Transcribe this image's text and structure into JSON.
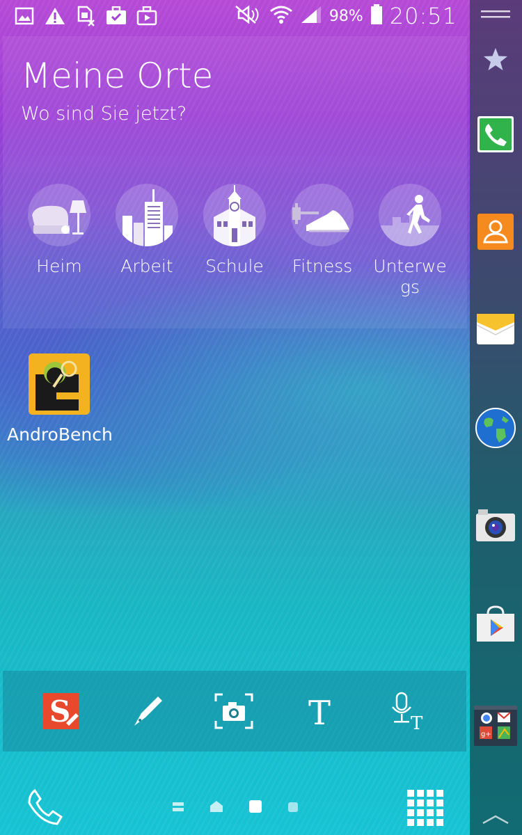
{
  "status_bar": {
    "left_icons": [
      "gallery-icon",
      "warning-icon",
      "sim-error-icon",
      "briefcase-check-icon",
      "briefcase-play-icon"
    ],
    "battery_percent": "98%",
    "time": "20:51"
  },
  "places_widget": {
    "title": "Meine Orte",
    "subtitle": "Wo sind Sie jetzt?",
    "places": [
      {
        "label": "Heim",
        "icon": "home-place-icon"
      },
      {
        "label": "Arbeit",
        "icon": "work-place-icon"
      },
      {
        "label": "Schule",
        "icon": "school-place-icon"
      },
      {
        "label": "Fitness",
        "icon": "fitness-place-icon"
      },
      {
        "label": "Unterwegs",
        "icon": "on-the-move-place-icon"
      }
    ]
  },
  "home_apps": [
    {
      "label": "AndroBench",
      "icon_text": "AndroBench"
    }
  ],
  "pen_tools": [
    "s-note-icon",
    "pen-icon",
    "screen-capture-icon",
    "text-icon",
    "voice-text-icon"
  ],
  "dock": {
    "phone_icon": "phone-icon",
    "apps_icon": "apps-grid-icon"
  },
  "edge_panel": {
    "items": [
      "menu-handle-icon",
      "favorites-star-icon",
      "phone-app-icon",
      "contacts-app-icon",
      "messages-app-icon",
      "internet-app-icon",
      "camera-app-icon",
      "play-store-app-icon",
      "google-folder-icon",
      "expand-up-icon"
    ]
  },
  "colors": {
    "edge_phone": "#2fb34a",
    "edge_contacts": "#f58a1f",
    "s_note": "#e8482c",
    "app_bg": "#f3b220"
  }
}
